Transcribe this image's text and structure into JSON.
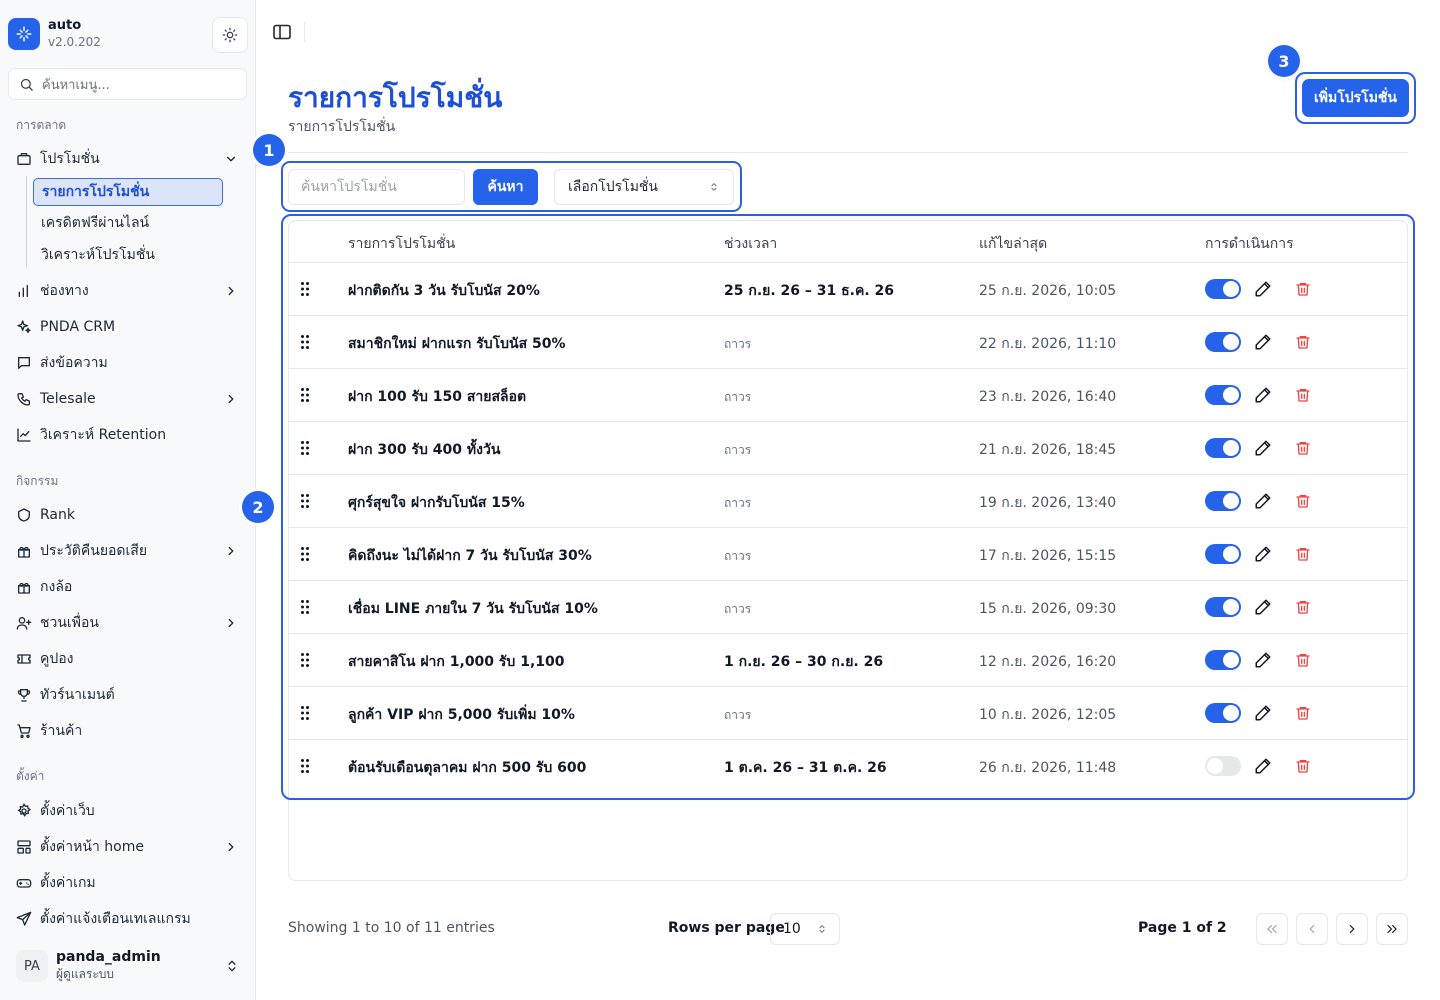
{
  "app": {
    "name": "auto",
    "version": "v2.0.202"
  },
  "sidebar": {
    "search_placeholder": "ค้นหาเมนู...",
    "sections": {
      "marketing": "การตลาด",
      "activities": "กิจกรรม",
      "settings": "ตั้งค่า"
    },
    "promotion": {
      "label": "โปรโมชั่น",
      "sub": [
        "รายการโปรโมชั่น",
        "เครดิตฟรีผ่านไลน์",
        "วิเคราะห์โปรโมชั่น"
      ]
    },
    "marketing_items": [
      "ช่องทาง",
      "PNDA CRM",
      "ส่งข้อความ",
      "Telesale",
      "วิเคราะห์ Retention"
    ],
    "activity_items": [
      "Rank",
      "ประวัติคืนยอดเสีย",
      "กงล้อ",
      "ชวนเพื่อน",
      "คูปอง",
      "ทัวร์นาเมนต์",
      "ร้านค้า"
    ],
    "settings_items": [
      "ตั้งค่าเว็บ",
      "ตั้งค่าหน้า home",
      "ตั้งค่าเกม",
      "ตั้งค่าแจ้งเตือนเทเลแกรม"
    ],
    "user": {
      "initials": "PA",
      "name": "panda_admin",
      "role": "ผู้ดูแลระบบ"
    }
  },
  "header": {
    "title": "รายการโปรโมชั่น",
    "subtitle": "รายการโปรโมชั่น",
    "add_button": "เพิ่มโปรโมชั่น"
  },
  "badges": {
    "one": "1",
    "two": "2",
    "three": "3"
  },
  "filter": {
    "search_placeholder": "ค้นหาโปรโมชั่น",
    "search_button": "ค้นหา",
    "select_value": "เลือกโปรโมชั่น"
  },
  "table": {
    "columns": [
      "รายการโปรโมชั่น",
      "ช่วงเวลา",
      "แก้ไขล่าสุด",
      "การดำเนินการ"
    ],
    "rows": [
      {
        "name": "ฝากติดกัน 3 วัน รับโบนัส 20%",
        "period": "25 ก.ย. 26 – 31 ธ.ค. 26",
        "permanent": false,
        "updated": "25 ก.ย. 2026, 10:05",
        "enabled": true
      },
      {
        "name": "สมาชิกใหม่ ฝากแรก รับโบนัส 50%",
        "period": "ถาวร",
        "permanent": true,
        "updated": "22 ก.ย. 2026, 11:10",
        "enabled": true
      },
      {
        "name": "ฝาก 100 รับ 150 สายสล็อต",
        "period": "ถาวร",
        "permanent": true,
        "updated": "23 ก.ย. 2026, 16:40",
        "enabled": true
      },
      {
        "name": "ฝาก 300 รับ 400 ทั้งวัน",
        "period": "ถาวร",
        "permanent": true,
        "updated": "21 ก.ย. 2026, 18:45",
        "enabled": true
      },
      {
        "name": "ศุกร์สุขใจ ฝากรับโบนัส 15%",
        "period": "ถาวร",
        "permanent": true,
        "updated": "19 ก.ย. 2026, 13:40",
        "enabled": true
      },
      {
        "name": "คิดถึงนะ ไม่ได้ฝาก 7 วัน รับโบนัส 30%",
        "period": "ถาวร",
        "permanent": true,
        "updated": "17 ก.ย. 2026, 15:15",
        "enabled": true
      },
      {
        "name": "เชื่อม LINE ภายใน 7 วัน รับโบนัส 10%",
        "period": "ถาวร",
        "permanent": true,
        "updated": "15 ก.ย. 2026, 09:30",
        "enabled": true
      },
      {
        "name": "สายคาสิโน ฝาก 1,000 รับ 1,100",
        "period": "1 ก.ย. 26 – 30 ก.ย. 26",
        "permanent": false,
        "updated": "12 ก.ย. 2026, 16:20",
        "enabled": true
      },
      {
        "name": "ลูกค้า VIP ฝาก 5,000 รับเพิ่ม 10%",
        "period": "ถาวร",
        "permanent": true,
        "updated": "10 ก.ย. 2026, 12:05",
        "enabled": true
      },
      {
        "name": "ต้อนรับเดือนตุลาคม ฝาก 500 รับ 600",
        "period": "1 ต.ค. 26 – 31 ต.ค. 26",
        "permanent": false,
        "updated": "26 ก.ย. 2026, 11:48",
        "enabled": false
      }
    ]
  },
  "footer": {
    "showing": "Showing 1 to 10 of 11 entries",
    "rows_per_page_label": "Rows per page",
    "rows_per_page_value": "10",
    "page_info": "Page 1 of 2"
  },
  "colors": {
    "accent": "#2563eb",
    "danger": "#ef4444"
  }
}
